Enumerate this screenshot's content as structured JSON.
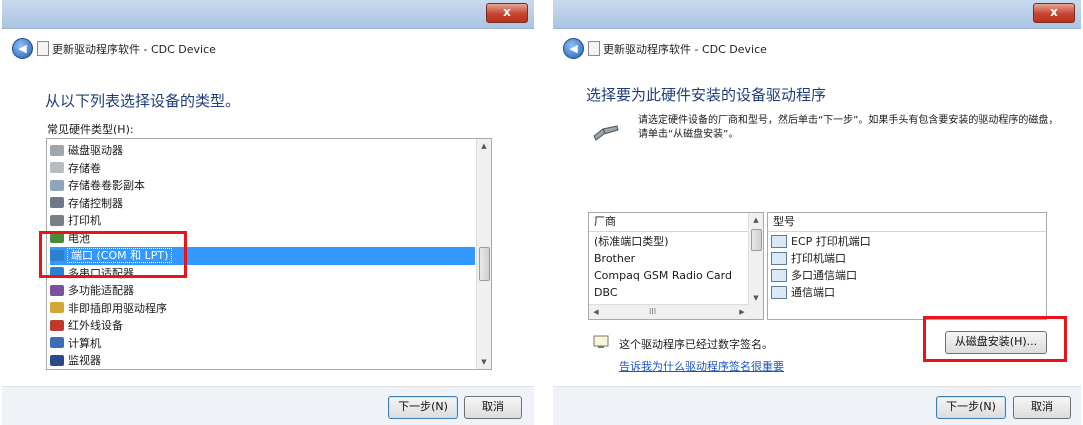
{
  "left_window": {
    "close_label": "x",
    "title": "更新驱动程序软件 - CDC Device",
    "heading": "从以下列表选择设备的类型。",
    "list_label": "常见硬件类型(H):",
    "items": [
      {
        "label": "磁盘驱动器",
        "icon": "disk-drive-icon"
      },
      {
        "label": "存储卷",
        "icon": "storage-volume-icon"
      },
      {
        "label": "存储卷卷影副本",
        "icon": "shadow-copy-icon"
      },
      {
        "label": "存储控制器",
        "icon": "storage-controller-icon"
      },
      {
        "label": "打印机",
        "icon": "printer-icon"
      },
      {
        "label": "电池",
        "icon": "battery-icon"
      },
      {
        "label": "端口 (COM 和 LPT)",
        "icon": "port-icon"
      },
      {
        "label": "多串口适配器",
        "icon": "serial-adapter-icon"
      },
      {
        "label": "多功能适配器",
        "icon": "multifunction-icon"
      },
      {
        "label": "非即插即用驱动程序",
        "icon": "non-pnp-icon"
      },
      {
        "label": "红外线设备",
        "icon": "infrared-icon"
      },
      {
        "label": "计算机",
        "icon": "computer-icon"
      },
      {
        "label": "监视器",
        "icon": "monitor-icon"
      }
    ],
    "selected_index": 6,
    "next_label": "下一步(N)",
    "cancel_label": "取消"
  },
  "right_window": {
    "close_label": "x",
    "title": "更新驱动程序软件 - CDC Device",
    "heading": "选择要为此硬件安装的设备驱动程序",
    "instruction": "请选定硬件设备的厂商和型号，然后单击“下一步”。如果手头有包含要安装的驱动程序的磁盘，请单击“从磁盘安装”。",
    "manufacturer_header": "厂商",
    "manufacturers": [
      "(标准端口类型)",
      "Brother",
      "Compaq GSM Radio Card",
      "DBC"
    ],
    "hscroll_glyph": "III",
    "model_header": "型号",
    "models": [
      "ECP 打印机端口",
      "打印机端口",
      "多口通信端口",
      "通信端口"
    ],
    "signed_text": "这个驱动程序已经过数字签名。",
    "signed_link": "告诉我为什么驱动程序签名很重要",
    "have_disk_label": "从磁盘安装(H)...",
    "next_label": "下一步(N)",
    "cancel_label": "取消"
  },
  "colors": {
    "highlight": "#e8141b",
    "selection": "#3399ff",
    "heading": "#1f3d7a",
    "link": "#1a55c4"
  }
}
